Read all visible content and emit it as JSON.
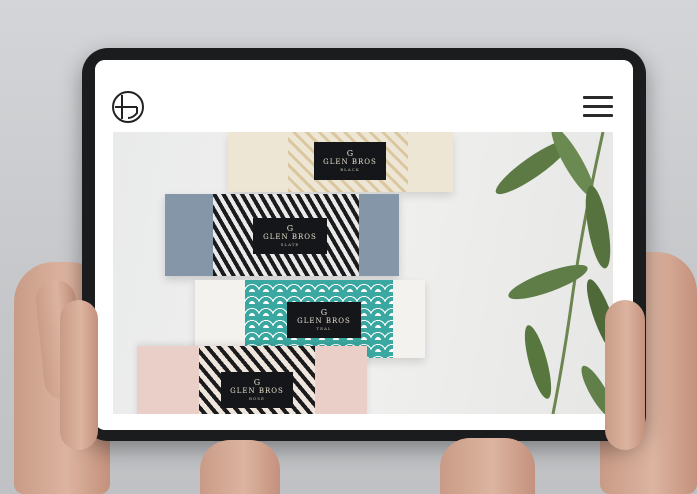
{
  "page": {
    "logo_icon": "hg-monogram-icon",
    "menu_icon": "hamburger-menu-icon"
  },
  "soaps": [
    {
      "brand": "GLEN BROS",
      "sub": "BLACK",
      "mono": "G",
      "pattern_color": "#d9c49a",
      "bar_color": "#eee6d4"
    },
    {
      "brand": "GLEN BROS",
      "sub": "SLATE",
      "mono": "G",
      "pattern_color": "#1b1b1d",
      "bar_color": "#8596a9"
    },
    {
      "brand": "GLEN BROS",
      "sub": "TEAL",
      "mono": "G",
      "pattern_color": "#3aa8a0",
      "bar_color": "#f3f2ee"
    },
    {
      "brand": "GLEN BROS",
      "sub": "ROSE",
      "mono": "G",
      "pattern_color": "#1b1b1d",
      "bar_color": "#e9cfc8"
    }
  ],
  "colors": {
    "tablet_bezel": "#1b1c1e",
    "leaf": "#5d7a45",
    "skin": "#d7ab96"
  }
}
